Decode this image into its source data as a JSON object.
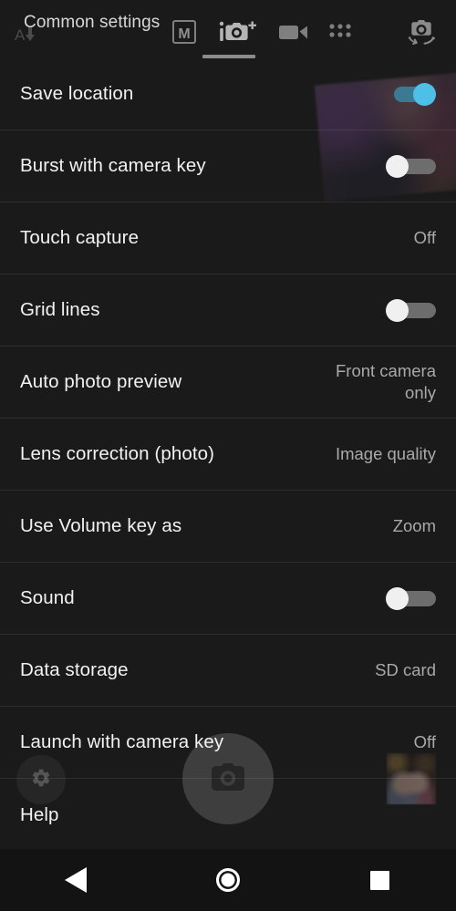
{
  "topbar": {
    "title": "Common settings",
    "flash_icon": "auto-flash-icon",
    "modes": [
      {
        "name": "manual-mode",
        "icon": "m-letter-icon",
        "label": "M",
        "active": false
      },
      {
        "name": "intelligent-auto-mode",
        "icon": "camera-plus-icon",
        "label": "",
        "active": true
      },
      {
        "name": "video-mode",
        "icon": "video-camera-icon",
        "label": "",
        "active": false
      },
      {
        "name": "camera-apps-mode",
        "icon": "grid-dots-icon",
        "label": "",
        "active": false
      }
    ],
    "switch_camera_icon": "switch-camera-icon"
  },
  "settings": [
    {
      "label": "Save location",
      "type": "toggle",
      "state": "on",
      "value": ""
    },
    {
      "label": "Burst with camera key",
      "type": "toggle",
      "state": "off",
      "value": ""
    },
    {
      "label": "Touch capture",
      "type": "value",
      "state": "",
      "value": "Off"
    },
    {
      "label": "Grid lines",
      "type": "toggle",
      "state": "off",
      "value": ""
    },
    {
      "label": "Auto photo preview",
      "type": "value",
      "state": "",
      "value": "Front camera\nonly"
    },
    {
      "label": "Lens correction (photo)",
      "type": "value",
      "state": "",
      "value": "Image quality"
    },
    {
      "label": "Use Volume key as",
      "type": "value",
      "state": "",
      "value": "Zoom"
    },
    {
      "label": "Sound",
      "type": "toggle",
      "state": "off",
      "value": ""
    },
    {
      "label": "Data storage",
      "type": "value",
      "state": "",
      "value": "SD card"
    },
    {
      "label": "Launch with camera key",
      "type": "value",
      "state": "",
      "value": "Off"
    },
    {
      "label": "Help",
      "type": "none",
      "state": "",
      "value": ""
    }
  ],
  "camera_overlay": {
    "settings_button_icon": "gear-icon",
    "shutter_button_icon": "camera-icon",
    "gallery_thumbnail": "photo-thumbnail"
  },
  "navbar": {
    "back_icon": "back-triangle-icon",
    "home_icon": "home-circle-icon",
    "recents_icon": "recents-square-icon"
  },
  "colors": {
    "background": "#1a1a1a",
    "toggle_on_thumb": "#4ec0e8",
    "toggle_on_track": "#3a7b93",
    "toggle_off_thumb": "#f0f0f0",
    "toggle_off_track": "#6d6d6d",
    "label_text": "#f2f2f2",
    "value_text": "#a9a9a9",
    "navbar_background": "#131313"
  }
}
